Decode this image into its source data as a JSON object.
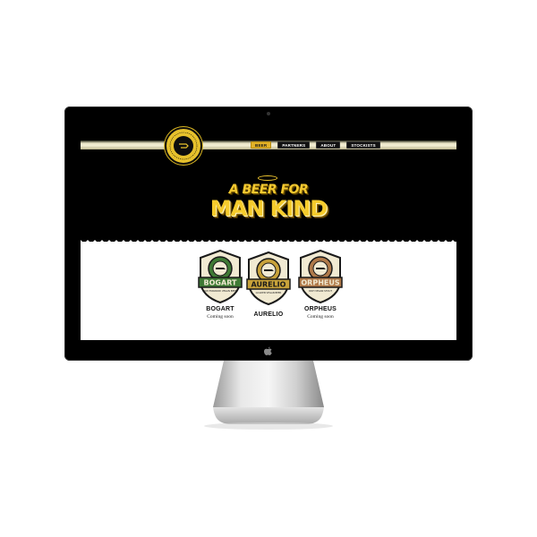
{
  "nav": {
    "items": [
      {
        "label": "BEER",
        "active": true
      },
      {
        "label": "PARTNERS",
        "active": false
      },
      {
        "label": "ABOUT",
        "active": false
      },
      {
        "label": "STOCKISTS",
        "active": false
      }
    ]
  },
  "hero": {
    "line1": "A BEER FOR",
    "line2": "MAN KIND"
  },
  "products": [
    {
      "name": "BOGART",
      "badge_label": "BOGART",
      "subtitle": "HOP-FORWARD VEGAN BEER",
      "status": "Coming soon",
      "color": "#3f7a35"
    },
    {
      "name": "AURELIO",
      "badge_label": "AURELIO",
      "subtitle": "GOLDEN VEGAN BEER",
      "status": "",
      "color": "#c8a23a"
    },
    {
      "name": "ORPHEUS",
      "badge_label": "ORPHEUS",
      "subtitle": "RICH VEGAN STOUT",
      "status": "Coming soon",
      "color": "#b07a4a"
    }
  ],
  "colors": {
    "accent": "#f2c830",
    "screen_bg": "#000000",
    "content_bg": "#ffffff"
  },
  "icons": {
    "brand": "brand-logo-icon",
    "os": "apple-logo-icon"
  }
}
